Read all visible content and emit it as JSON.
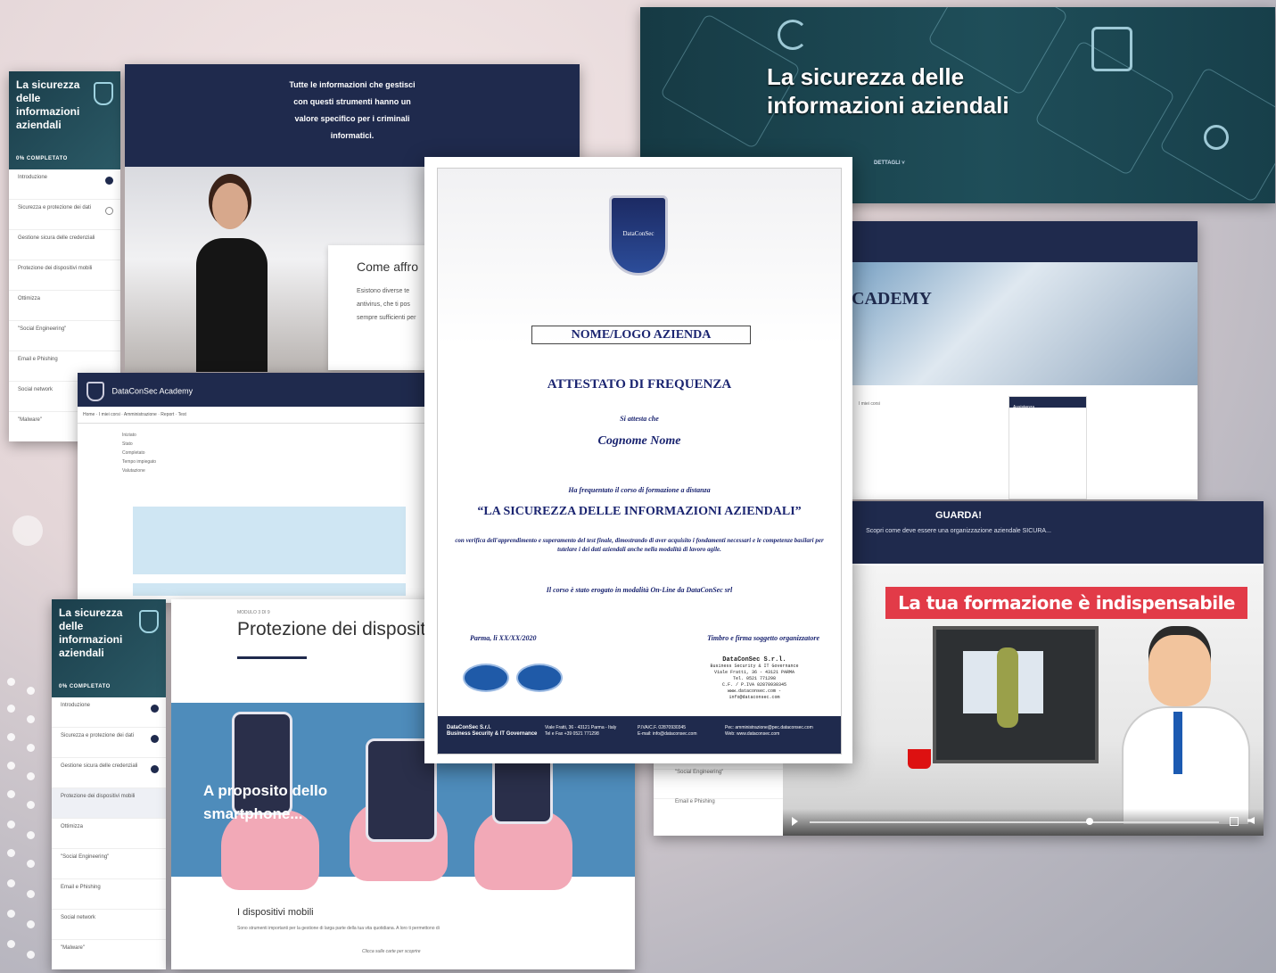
{
  "course_panel_top": {
    "title": "La sicurezza delle informazioni aziendali",
    "status": "0% COMPLETATO",
    "items": [
      "Introduzione",
      "Sicurezza e protezione dei dati",
      "Gestione sicura delle credenziali",
      "Protezione dei dispositivi mobili",
      "Ottimizza",
      "\"Social Engineering\"",
      "Email e Phishing",
      "Social network",
      "\"Malware\""
    ]
  },
  "video_top": {
    "caption": "Tutte le informazioni che gestisci con questi strumenti hanno un valore specifico per i criminali informatici.",
    "card_title": "Come affro",
    "card_lines": [
      "Esistono diverse te",
      "antivirus, che ti pos",
      "sempre sufficienti per"
    ]
  },
  "admin_panel": {
    "brand": "DataConSec Academy",
    "tabs": [
      "Home",
      "I miei corsi",
      "Amministrazione",
      "Report",
      "Test"
    ],
    "rows": [
      "Iniziato",
      "Stato",
      "Completato",
      "Tempo impiegato",
      "Valutazione"
    ]
  },
  "course_panel_bottom": {
    "title": "La sicurezza delle informazioni aziendali",
    "status": "0% COMPLETATO",
    "items": [
      "Introduzione",
      "Sicurezza e protezione dei dati",
      "Gestione sicura delle credenziali",
      "Protezione dei dispositivi mobili",
      "Ottimizza",
      "\"Social Engineering\"",
      "Email e Phishing",
      "Social network",
      "\"Malware\""
    ]
  },
  "protezione_panel": {
    "crumb": "MODULO 3 DI 9",
    "title": "Protezione dei disposit",
    "illustration_text": "A proposito dello smartphone...",
    "section": "I dispositivi mobili",
    "section_text": "Sono strumenti importanti per la gestione di larga parte della tua vita quotidiana. A loro ti permettono di",
    "footer": "Clicca sulle carte per scoprire"
  },
  "banner": {
    "title_line1": "La sicurezza delle",
    "title_line2": "informazioni aziendali",
    "button": "DETTAGLI ˅"
  },
  "academy_panel": {
    "logo_text": "CADEMY",
    "side_title": "Assistenza",
    "small": "I miei corsi"
  },
  "video_bottom": {
    "guarda": "GUARDA!",
    "subtitle": "Scopri come deve essere una organizzazione aziendale SICURA...",
    "banner": "La tua formazione è indispensabile",
    "menu": [
      "\"Social Engineering\"",
      "Email e Phishing"
    ]
  },
  "certificate": {
    "logo_text": "DataConSec",
    "company_box": "NOME/LOGO AZIENDA",
    "title": "ATTESTATO DI FREQUENZA",
    "attesta": "Si attesta che",
    "name": "Cognome Nome",
    "frequentato": "Ha frequentato il corso di formazione a distanza",
    "course": "“LA SICUREZZA DELLE INFORMAZIONI AZIENDALI”",
    "description": "con verifica dell'apprendimento e superamento del test finale, dimostrando di aver acquisito i fondamenti necessari e le competenze basilari per tutelare i dei dati aziendali anche nella modalità di lavoro agile.",
    "erogato": "Il corso è stato erogato in modalità On-Line da DataConSec srl",
    "place_date": "Parma, li XX/XX/2020",
    "signature_label": "Timbro e firma soggetto organizzatore",
    "stamp_lines": [
      "DataConSec S.r.l.",
      "Business Security & IT Governance",
      "Viale Fratti, 36 - 43121 PARMA",
      "Tel. 0521 771298",
      "C.F. / P.IVA 02870930345",
      "www.dataconsec.com - info@dataconsec.com"
    ],
    "footer": {
      "company": "DataConSec S.r.l.",
      "company_sub": "Business Security & IT Governance",
      "address": "Viale Fratti, 36 - 43121 Parma - Italy",
      "phone": "Tel e Fax +39 0521 771298",
      "piva": "P.IVA/C.F. 02870930345",
      "email": "E-mail: info@dataconsec.com",
      "pec": "Pec: amministrazione@pec.dataconsec.com",
      "web": "Web: www.dataconsec.com"
    }
  },
  "colors": {
    "navy": "#1f2a4d",
    "teal": "#1f4e59",
    "red": "#e23b48",
    "cert_blue": "#1a2470"
  }
}
